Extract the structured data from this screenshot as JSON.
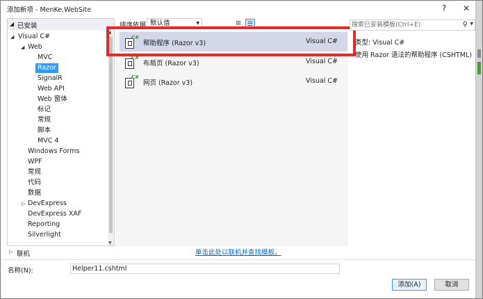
{
  "window": {
    "title": "添加新项 - MenKe.WebSite",
    "help_label": "?",
    "close_label": "✕"
  },
  "left_pane": {
    "installed_label": "已安装",
    "tree": [
      {
        "label": "Visual C#",
        "expanded": true
      },
      {
        "label": "Web",
        "expanded": true
      },
      {
        "label": "MVC"
      },
      {
        "label": "Razor",
        "selected": true
      },
      {
        "label": "SignalR"
      },
      {
        "label": "Web API"
      },
      {
        "label": "Web 窗体"
      },
      {
        "label": "标记"
      },
      {
        "label": "常规"
      },
      {
        "label": "脚本"
      },
      {
        "label": "MVC 4"
      },
      {
        "label": "Windows Forms"
      },
      {
        "label": "WPF"
      },
      {
        "label": "常规"
      },
      {
        "label": "代码"
      },
      {
        "label": "数据"
      },
      {
        "label": "DevExpress",
        "expandable": true
      },
      {
        "label": "DevExpress XAF"
      },
      {
        "label": "Reporting"
      },
      {
        "label": "Silverlight"
      }
    ],
    "online_label": "联机"
  },
  "sort_bar": {
    "label": "排序依据:",
    "value": "默认值",
    "grid_view_icon": "grid-view-icon",
    "list_view_icon": "list-view-icon"
  },
  "templates": [
    {
      "name": "帮助程序 (Razor v3)",
      "language": "Visual C#",
      "selected": true
    },
    {
      "name": "布局页 (Razor v3)",
      "language": "Visual C#"
    },
    {
      "name": "网页 (Razor v3)",
      "language": "Visual C#"
    }
  ],
  "online_link": "单击此处以联机并查找模板。",
  "search": {
    "placeholder": "搜索已安装模板(Ctrl+E)"
  },
  "details": {
    "type_text": "类型:  Visual C#",
    "description": "使用 Razor 语法的帮助程序 (CSHTML)"
  },
  "bottom": {
    "name_label": "名称(N):",
    "name_value": "Helper11.cshtml",
    "add_button": "添加(A)",
    "cancel_button": "取消"
  },
  "colors": {
    "highlight": "#e8292c",
    "selection": "#3399ff",
    "selected_template": "#d3d7e8",
    "link": "#0066cc"
  }
}
